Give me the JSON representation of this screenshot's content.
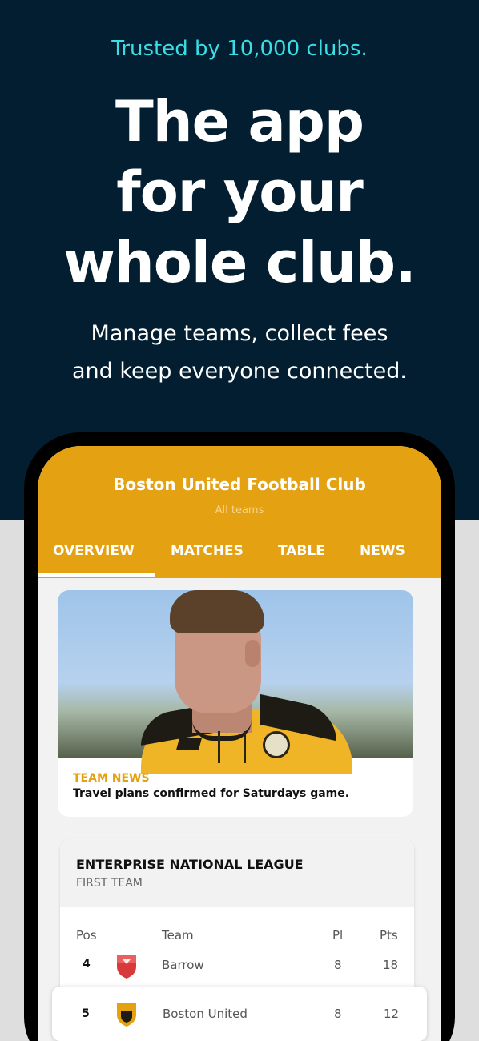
{
  "hero": {
    "tagline": "Trusted by 10,000 clubs.",
    "headline_lines": [
      "The app",
      "for your",
      "whole club."
    ],
    "subhead_lines": [
      "Manage teams, collect fees",
      "and keep everyone connected."
    ]
  },
  "app": {
    "club_name": "Boston United Football Club",
    "club_sub": "All teams",
    "tabs": [
      {
        "label": "OVERVIEW",
        "active": true
      },
      {
        "label": "MATCHES",
        "active": false
      },
      {
        "label": "TABLE",
        "active": false
      },
      {
        "label": "NEWS",
        "active": false
      }
    ],
    "news": {
      "kicker": "TEAM NEWS",
      "title": "Travel plans confirmed for Saturdays game."
    },
    "league": {
      "name": "ENTERPRISE NATIONAL LEAGUE",
      "team": "FIRST TEAM",
      "columns": {
        "pos": "Pos",
        "team": "Team",
        "pl": "Pl",
        "pts": "Pts"
      },
      "rows": [
        {
          "pos": "4",
          "team": "Barrow",
          "pl": "8",
          "pts": "18",
          "crest": "barrow-crest-icon"
        },
        {
          "pos": "5",
          "team": "Boston United",
          "pl": "8",
          "pts": "12",
          "crest": "boston-united-crest-icon"
        }
      ]
    }
  },
  "colors": {
    "hero_bg": "#021e30",
    "tagline": "#3bdde7",
    "accent": "#e4a112"
  }
}
